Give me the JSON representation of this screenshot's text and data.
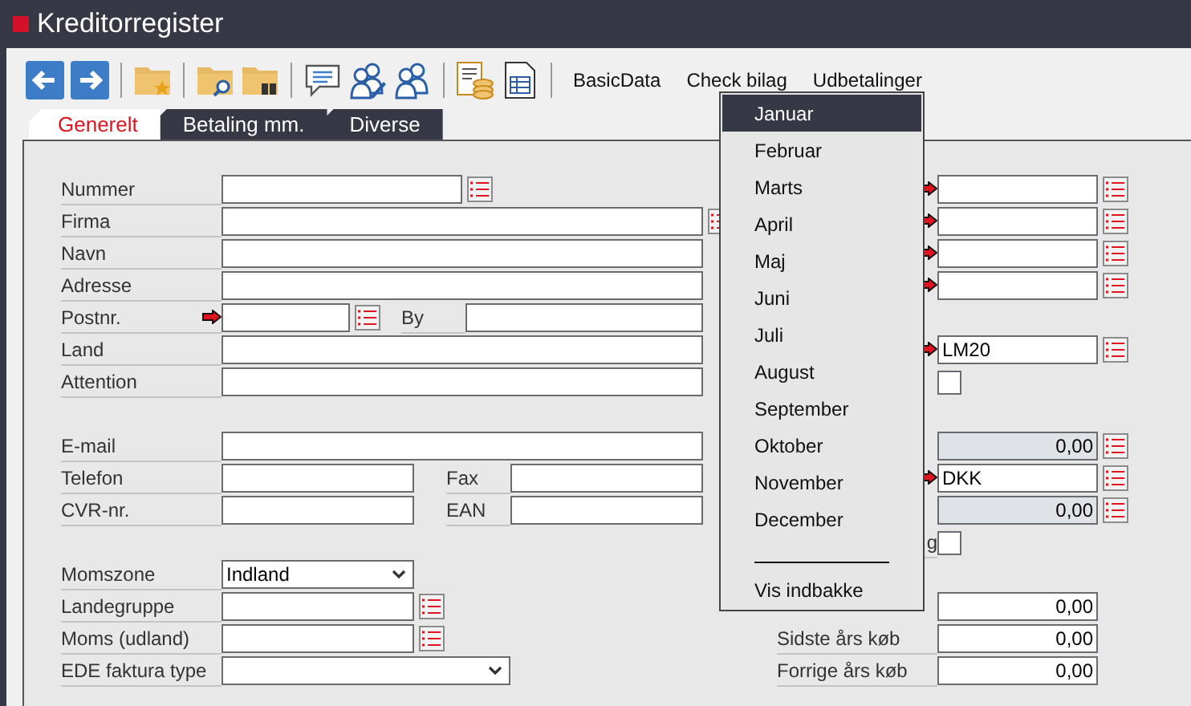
{
  "window": {
    "title": "Kreditorregister"
  },
  "toolbar": {
    "links": [
      "BasicData",
      "Check bilag",
      "Udbetalinger"
    ]
  },
  "tabs": [
    {
      "label": "Generelt",
      "selected": true
    },
    {
      "label": "Betaling mm.",
      "selected": false
    },
    {
      "label": "Diverse",
      "selected": false
    }
  ],
  "left_groups": [
    [
      {
        "label": "Nummer",
        "kind": "text",
        "lookup": true,
        "required": false
      },
      {
        "label": "Firma",
        "kind": "text",
        "lookup": true,
        "required": false
      },
      {
        "label": "Navn",
        "kind": "text",
        "lookup": false,
        "required": false
      },
      {
        "label": "Adresse",
        "kind": "text",
        "lookup": false,
        "required": false
      },
      {
        "label": "Postnr.",
        "kind": "text",
        "lookup": true,
        "required": true,
        "pair": {
          "label": "By"
        }
      },
      {
        "label": "Land",
        "kind": "text",
        "lookup": false,
        "required": false
      },
      {
        "label": "Attention",
        "kind": "text",
        "lookup": false,
        "required": false
      }
    ],
    [
      {
        "label": "E-mail",
        "kind": "text",
        "lookup": false,
        "required": false
      },
      {
        "label": "Telefon",
        "kind": "text",
        "lookup": false,
        "required": false,
        "pair": {
          "label": "Fax"
        }
      },
      {
        "label": "CVR-nr.",
        "kind": "text",
        "lookup": false,
        "required": false,
        "pair": {
          "label": "EAN"
        }
      }
    ],
    [
      {
        "label": "Momszone",
        "kind": "select",
        "value": "Indland",
        "lookup": false,
        "required": false
      },
      {
        "label": "Landegruppe",
        "kind": "text",
        "lookup": true,
        "required": false
      },
      {
        "label": "Moms (udland)",
        "kind": "text",
        "lookup": true,
        "required": false
      },
      {
        "label": "EDE faktura type",
        "kind": "select",
        "lookup": false,
        "required": false
      }
    ]
  ],
  "right_groups": [
    [
      {
        "kind": "text",
        "lookup": true,
        "required": true,
        "readonly": false
      },
      {
        "kind": "text",
        "lookup": true,
        "required": true,
        "readonly": false
      },
      {
        "kind": "text",
        "lookup": true,
        "required": true,
        "readonly": false
      },
      {
        "kind": "text",
        "lookup": true,
        "required": true,
        "readonly": false
      }
    ],
    [
      {
        "kind": "text",
        "value": "LM20",
        "lookup": true,
        "required": true,
        "readonly": false
      },
      {
        "kind": "checkbox",
        "checked": false
      }
    ],
    [
      {
        "kind": "amount",
        "value": "0,00",
        "lookup": true,
        "required": false,
        "readonly": true
      },
      {
        "kind": "text",
        "value": "DKK",
        "lookup": true,
        "required": true,
        "readonly": false
      },
      {
        "kind": "amount",
        "value": "0,00",
        "lookup": true,
        "required": false,
        "readonly": true
      },
      {
        "kind": "checkbox",
        "label": "g",
        "checked": false
      }
    ],
    [
      {
        "kind": "amount",
        "value": "0,00",
        "lookup": false,
        "required": false,
        "readonly": false
      },
      {
        "kind": "amount",
        "label": "Sidste års køb",
        "value": "0,00",
        "lookup": false,
        "required": false,
        "readonly": false
      },
      {
        "kind": "amount",
        "label": "Forrige års køb",
        "value": "0,00",
        "lookup": false,
        "required": false,
        "readonly": false
      }
    ]
  ],
  "menu": {
    "items": [
      {
        "kind": "item",
        "label": "Januar",
        "selected": true
      },
      {
        "kind": "item",
        "label": "Februar",
        "selected": false
      },
      {
        "kind": "item",
        "label": "Marts",
        "selected": false
      },
      {
        "kind": "item",
        "label": "April",
        "selected": false
      },
      {
        "kind": "item",
        "label": "Maj",
        "selected": false
      },
      {
        "kind": "item",
        "label": "Juni",
        "selected": false
      },
      {
        "kind": "item",
        "label": "Juli",
        "selected": false
      },
      {
        "kind": "item",
        "label": "August",
        "selected": false
      },
      {
        "kind": "item",
        "label": "September",
        "selected": false
      },
      {
        "kind": "item",
        "label": "Oktober",
        "selected": false
      },
      {
        "kind": "item",
        "label": "November",
        "selected": false
      },
      {
        "kind": "item",
        "label": "December",
        "selected": false
      },
      {
        "kind": "separator"
      },
      {
        "kind": "item",
        "label": "Vis indbakke",
        "selected": false
      }
    ]
  }
}
